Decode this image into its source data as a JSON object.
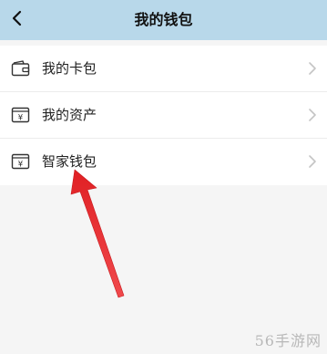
{
  "header": {
    "title": "我的钱包"
  },
  "menu": {
    "items": [
      {
        "label": "我的卡包",
        "icon": "wallet-icon"
      },
      {
        "label": "我的资产",
        "icon": "yen-box-icon"
      },
      {
        "label": "智家钱包",
        "icon": "yen-box-icon"
      }
    ]
  },
  "watermark": "56手游网",
  "colors": {
    "header_bg": "#b8d8ea",
    "page_bg": "#f5f5f5",
    "annotation_arrow": "#e5252a"
  }
}
